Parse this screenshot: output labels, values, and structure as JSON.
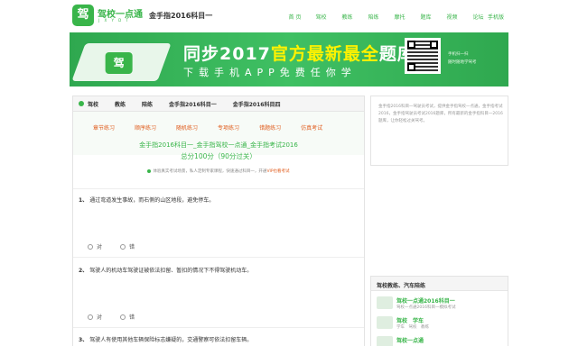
{
  "header": {
    "logo_text": "驾校一点通",
    "logo_mark": "驾",
    "logo_sub": "J X Y D T",
    "title": "金手指2016科目一",
    "nav": [
      "首 页",
      "驾校",
      "教练",
      "陪练",
      "摩托",
      "题库",
      "视频",
      "论坛"
    ],
    "nav_right": "手机版"
  },
  "banner": {
    "line1_a": "同步2017",
    "line1_b": "官方最新最全",
    "line1_c": "题库",
    "line2": "下载手机APP免费任你学",
    "side_1": "手机扫一扫",
    "side_2": "随时随地学驾考",
    "phone_mark": "驾"
  },
  "main": {
    "breadcrumb": [
      "驾校",
      "教练",
      "陪练",
      "金手指2016科目一",
      "金手指2016科目四"
    ],
    "subnav": [
      "章节练习",
      "顺序练习",
      "随机练习",
      "专项练习",
      "错题练习",
      "仿真考试"
    ],
    "heading": "金手指2016科目一_金手指驾校一点通_金手指考试2016",
    "score": "总分100分（90分过关）",
    "notice_text": "体验真实考试场景，私人定制专家课程，快速通过科目一，开通",
    "notice_vip": "VIP也看考试",
    "questions": [
      {
        "num": "1、",
        "text": "通过弯道发生事故，而右侧的山区地段，避免停车。",
        "options": [
          "对",
          "错"
        ]
      },
      {
        "num": "2、",
        "text": "驾驶人的机动车驾驶证被依法扣留、暂扣的情况下不得驾驶机动车。",
        "options": [
          "对",
          "错"
        ]
      },
      {
        "num": "3、",
        "text": "驾驶人有使用其他车辆保险标志嫌疑的，交通警察可依法扣留车辆。",
        "options": []
      }
    ]
  },
  "sidebar": {
    "intro": "金手指2016科目一驾驶员考试，提供金手指驾校一点通，金手指考试2016，金手指驾驶员考试2016题库，所有最新的金手指科目一2016题库，让你轻松过关驾考。",
    "list_title": "驾校教练、汽车陪练",
    "items": [
      {
        "title": "驾校一点通2016科目一",
        "desc": "驾校一点通2016科目一模拟考试"
      },
      {
        "title": "驾校　学车",
        "desc": "学车　驾校　教练"
      },
      {
        "title": "驾校一点通",
        "desc": ""
      }
    ]
  },
  "colors": {
    "brand": "#39b54a",
    "accent": "#e05a1a",
    "banner_highlight": "#fff200"
  }
}
